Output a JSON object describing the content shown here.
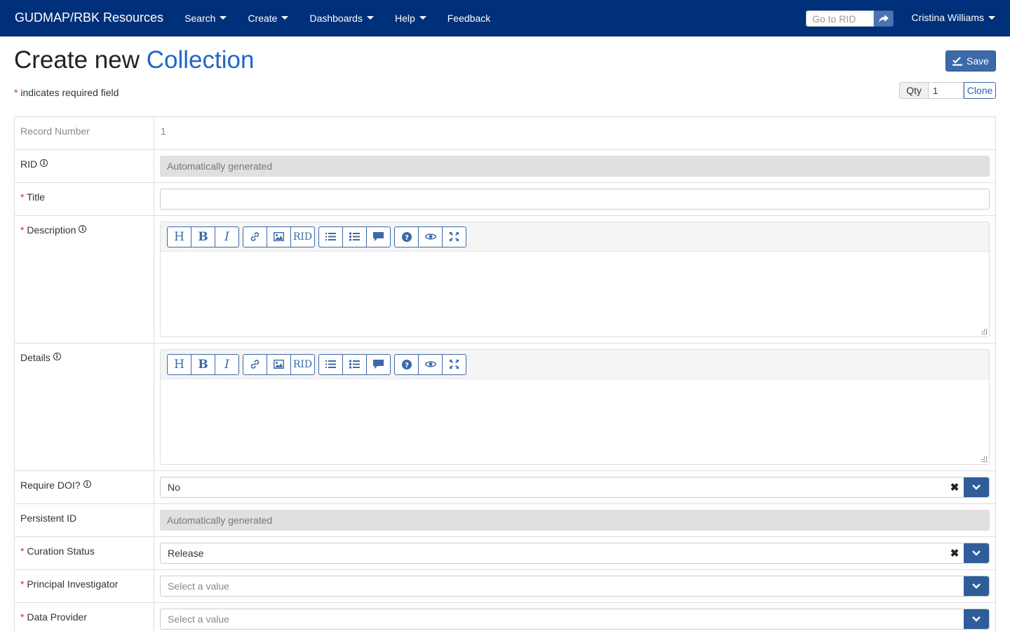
{
  "navbar": {
    "brand": "GUDMAP/RBK Resources",
    "menus": [
      "Search",
      "Create",
      "Dashboards",
      "Help"
    ],
    "feedback": "Feedback",
    "rid_placeholder": "Go to RID",
    "user": "Cristina Williams",
    "color": "#00307a"
  },
  "header": {
    "title_prefix": "Create new",
    "title_accent": "Collection",
    "required_star": "*",
    "required_note": "indicates required field",
    "save_label": "Save",
    "qty_label": "Qty",
    "qty_value": "1",
    "clone_label": "Clone"
  },
  "editor_toolbar": {
    "heading": "H",
    "bold": "B",
    "italic": "I",
    "rid": "RID"
  },
  "fields": {
    "record_number": {
      "label": "Record Number",
      "value": "1"
    },
    "rid": {
      "label": "RID",
      "value": "Automatically generated"
    },
    "title": {
      "star": "*",
      "label": "Title",
      "value": ""
    },
    "description": {
      "star": "*",
      "label": "Description"
    },
    "details": {
      "label": "Details"
    },
    "require_doi": {
      "label": "Require DOI?",
      "value": "No"
    },
    "persistent_id": {
      "label": "Persistent ID",
      "value": "Automatically generated"
    },
    "curation_status": {
      "star": "*",
      "label": "Curation Status",
      "value": "Release"
    },
    "principal_investigator": {
      "star": "*",
      "label": "Principal Investigator",
      "placeholder": "Select a value"
    },
    "data_provider": {
      "star": "*",
      "label": "Data Provider",
      "placeholder": "Select a value"
    }
  },
  "icons": {
    "info": "info-circle-icon",
    "clear": "times-icon",
    "dropdown": "chevron-down-icon",
    "save": "check-to-slot-icon",
    "go": "share-arrow-icon"
  }
}
